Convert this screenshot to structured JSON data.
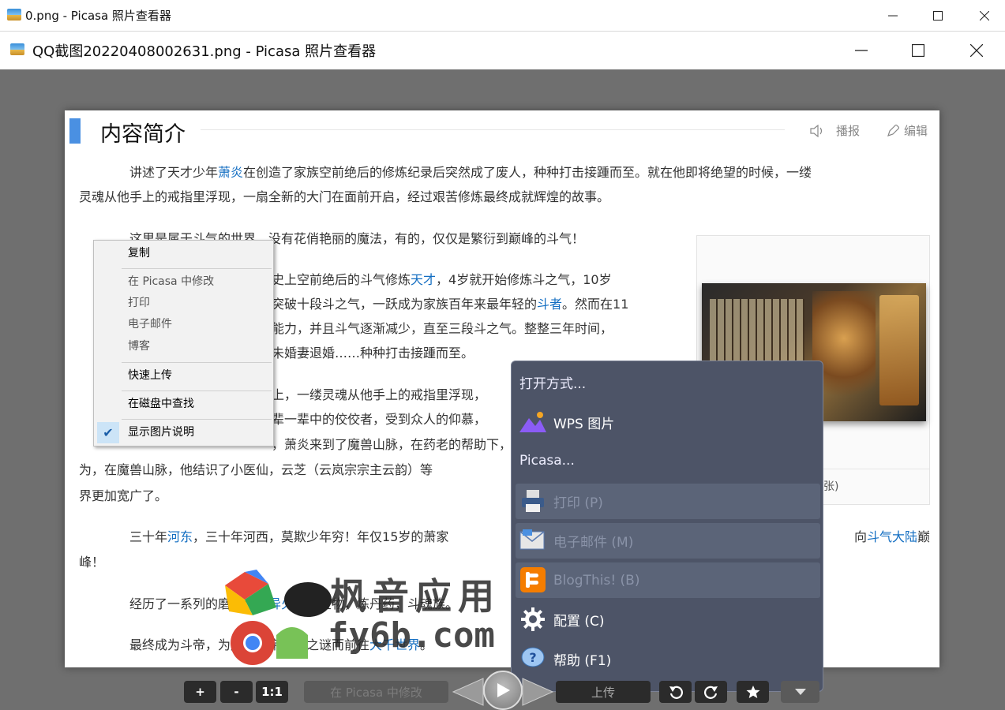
{
  "outer_window": {
    "title": "0.png - Picasa 照片查看器"
  },
  "inner_window": {
    "title": "QQ截图20220408002631.png - Picasa 照片查看器"
  },
  "photo": {
    "heading": "内容简介",
    "report_label": "播报",
    "edit_label": "编辑",
    "para1_a": "讲述了天才少年",
    "para1_link": "萧炎",
    "para1_b": "在创造了家族空前绝后的修炼纪录后突然成了废人，种种打击接踵而至。就在他即将绝望的时候，一缕",
    "para1_line2": "灵魂从他手上的戒指里浮现，一扇全新的大门在面前开启，经过艰苦修炼最终成就辉煌的故事。",
    "para2": "这里是属于斗气的世界，没有花俏艳丽的魔法，有的，仅仅是繁衍到巅峰的斗气！",
    "para3_l1a": "史上空前绝后的斗气修炼",
    "para3_l1link": "天才",
    "para3_l1b": "，4岁就开始修炼斗之气，10岁",
    "para3_l2a": "突破十段斗之气，一跃成为家族百年来最年轻的",
    "para3_l2link": "斗者",
    "para3_l2b": "。然而在11",
    "para3_l3": "能力，并且斗气逐渐减少，直至三段斗之气。整整三年时间，",
    "para3_l4": "未婚妻退婚……种种打击接踵而至。",
    "para4_l1": "上，一缕灵魂从他手上的戒指里浮现，",
    "para4_l2": "辈一辈中的佼佼者，受到众人的仰慕，",
    "para4_l3": "，萧炎来到了魔兽山脉，在药老的帮助下，为",
    "para4_l4": "为，在魔兽山脉，他结识了小医仙，云芝（云岚宗宗主云韵）等",
    "para4_l5": "界更加宽广了。",
    "para5_a": "三十年",
    "para5_link": "河东",
    "para5_b": "，三十年河西，莫欺少年穷！年仅15岁的萧家",
    "para5_c": "向",
    "para5_link2": "斗气大陆",
    "para5_d": "巅",
    "para5_l2": "峰！",
    "para6_a": "经历了一系列的磨练：收",
    "para6_link": "异火",
    "para6_b": "，寻宝物，炼丹药，斗魂族。",
    "para7_a": "最终成为斗帝，为解开斗帝失踪之谜而前往",
    "para7_link": "大千世界",
    "para7_b": "。",
    "image_caption": "张)"
  },
  "watermark": {
    "line1": "枫音应用",
    "line2": "fy6b.com"
  },
  "context_menu": {
    "copy": "复制",
    "edit_in_picasa": "在 Picasa 中修改",
    "print": "打印",
    "email": "电子邮件",
    "blog": "博客",
    "quick_upload": "快速上传",
    "find_on_disk": "在磁盘中查找",
    "show_caption": "显示图片说明"
  },
  "open_menu": {
    "open_with": "打开方式...",
    "wps": "WPS 图片",
    "picasa": "Picasa...",
    "print": "打印 (P)",
    "email": "电子邮件 (M)",
    "blog": "BlogThis!  (B)",
    "config": "配置 (C)",
    "help": "帮助 (F1)"
  },
  "toolbar": {
    "zoom_in": "+",
    "zoom_out": "-",
    "actual_size": "1:1",
    "edit_in_picasa": "在 Picasa 中修改",
    "upload": "上传"
  },
  "colors": {
    "link": "#136ec2",
    "accent_bar": "#4a90e2",
    "menu_dark": "#4d5467",
    "viewer_bg": "#6f6f6f"
  }
}
